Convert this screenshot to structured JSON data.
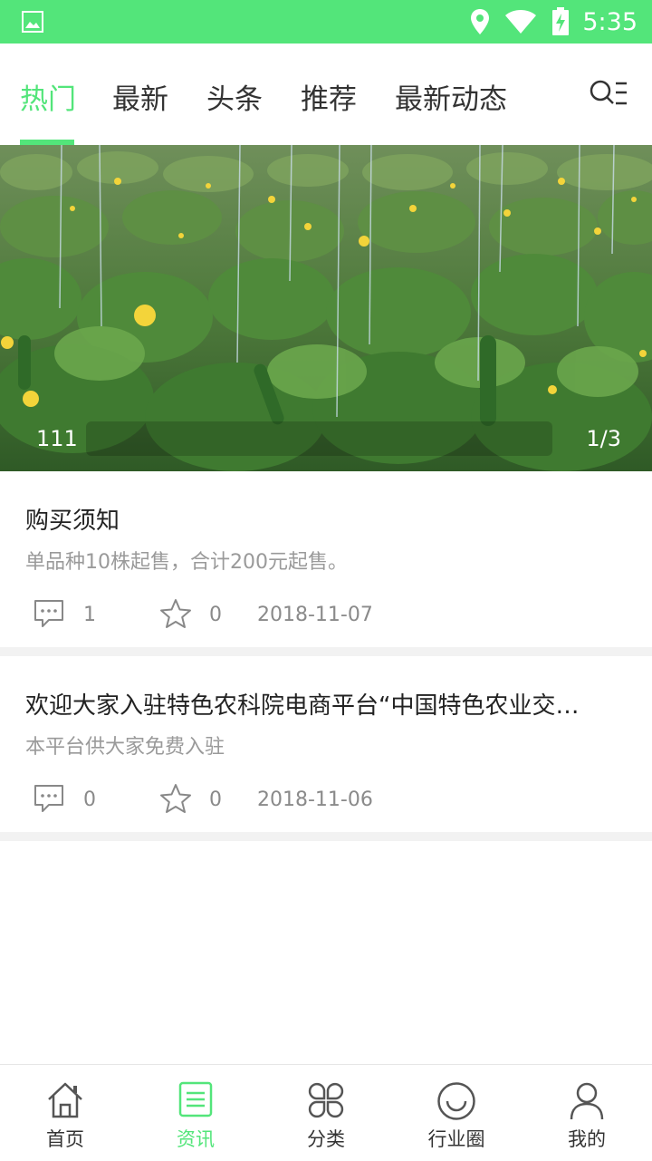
{
  "status_bar": {
    "time": "5:35",
    "icons": [
      "image-icon",
      "location-icon",
      "wifi-icon",
      "battery-charging-icon"
    ],
    "background": "#53e57a"
  },
  "top_tabs": {
    "items": [
      {
        "label": "热门",
        "active": true
      },
      {
        "label": "最新",
        "active": false
      },
      {
        "label": "头条",
        "active": false
      },
      {
        "label": "推荐",
        "active": false
      },
      {
        "label": "最新动态",
        "active": false
      }
    ],
    "accent": "#53e57a",
    "search_icon": "search-list-icon"
  },
  "banner": {
    "caption": "111",
    "counter": "1/3"
  },
  "articles": [
    {
      "title": "购买须知",
      "subtitle": "单品种10株起售，合计200元起售。",
      "comments": "1",
      "favorites": "0",
      "date": "2018-11-07"
    },
    {
      "title": "欢迎大家入驻特色农科院电商平台“中国特色农业交…",
      "subtitle": "本平台供大家免费入驻",
      "comments": "0",
      "favorites": "0",
      "date": "2018-11-06"
    }
  ],
  "bottom_nav": {
    "items": [
      {
        "label": "首页",
        "icon": "home-icon",
        "active": false
      },
      {
        "label": "资讯",
        "icon": "news-icon",
        "active": true
      },
      {
        "label": "分类",
        "icon": "category-icon",
        "active": false
      },
      {
        "label": "行业圈",
        "icon": "circle-smile-icon",
        "active": false
      },
      {
        "label": "我的",
        "icon": "user-icon",
        "active": false
      }
    ]
  }
}
